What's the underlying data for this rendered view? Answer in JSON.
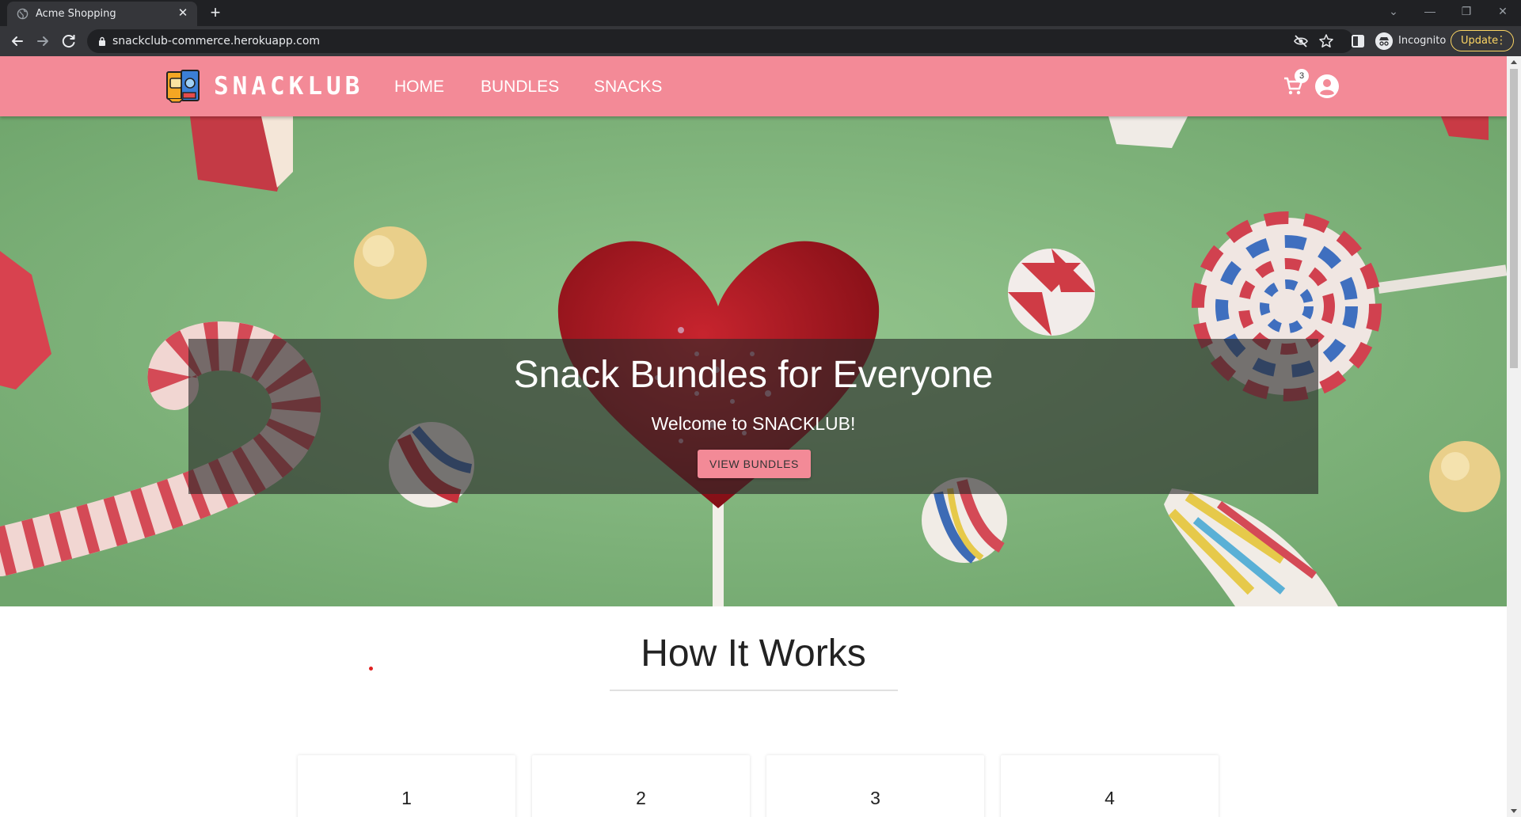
{
  "browser": {
    "tab_title": "Acme Shopping",
    "url": "snackclub-commerce.herokuapp.com",
    "profile_label": "Incognito",
    "update_label": "Update"
  },
  "site": {
    "logo_text": "SNACKLUB",
    "nav": [
      "HOME",
      "BUNDLES",
      "SNACKS"
    ],
    "cart_count": "3",
    "colors": {
      "brand_pink": "#f38a97",
      "hero_green": "#86b882"
    }
  },
  "hero": {
    "title": "Snack Bundles for Everyone",
    "subtitle": "Welcome to SNACKLUB!",
    "button": "VIEW BUNDLES"
  },
  "how_it_works": {
    "title": "How It Works",
    "steps": [
      "1",
      "2",
      "3",
      "4"
    ]
  },
  "icons": [
    "globe-icon",
    "close-icon",
    "plus-icon",
    "back-icon",
    "forward-icon",
    "reload-icon",
    "lock-icon",
    "eye-off-icon",
    "star-icon",
    "side-panel-icon",
    "incognito-icon",
    "kebab-icon",
    "cart-icon",
    "account-icon"
  ]
}
